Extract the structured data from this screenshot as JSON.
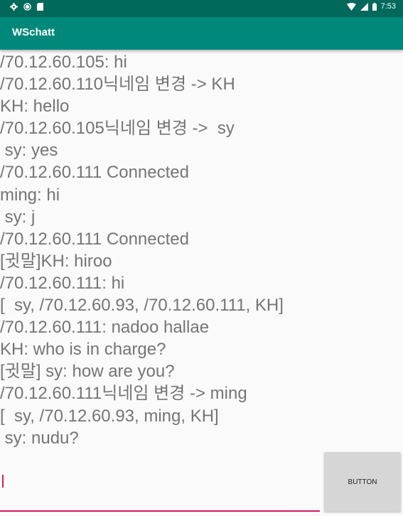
{
  "status_bar": {
    "time": "7:53",
    "icons_left": [
      "settings-icon",
      "circle-icon",
      "sd-card-icon"
    ],
    "icons_right": [
      "wifi-icon",
      "signal-icon",
      "battery-icon"
    ]
  },
  "app_bar": {
    "title": "WSchatt"
  },
  "chat": {
    "lines": [
      "/70.12.60.105: hi",
      "/70.12.60.110닉네임 변경 -> KH",
      "KH: hello",
      "/70.12.60.105닉네임 변경 ->  sy",
      " sy: yes",
      "/70.12.60.111 Connected",
      "ming: hi",
      " sy: j",
      "/70.12.60.111 Connected",
      "[귓말]KH: hiroo",
      "/70.12.60.111: hi",
      "[  sy, /70.12.60.93, /70.12.60.111, KH]",
      "/70.12.60.111: nadoo hallae",
      "KH: who is in charge?",
      "[귓말] sy: how are you?",
      "/70.12.60.111닉네임 변경 -> ming",
      "[  sy, /70.12.60.93, ming, KH]",
      " sy: nudu?"
    ]
  },
  "input": {
    "value": "",
    "placeholder": ""
  },
  "button": {
    "label": "BUTTON"
  },
  "colors": {
    "status_bar": "#00695c",
    "app_bar": "#00897b",
    "accent": "#d81b60",
    "text": "#757575"
  }
}
